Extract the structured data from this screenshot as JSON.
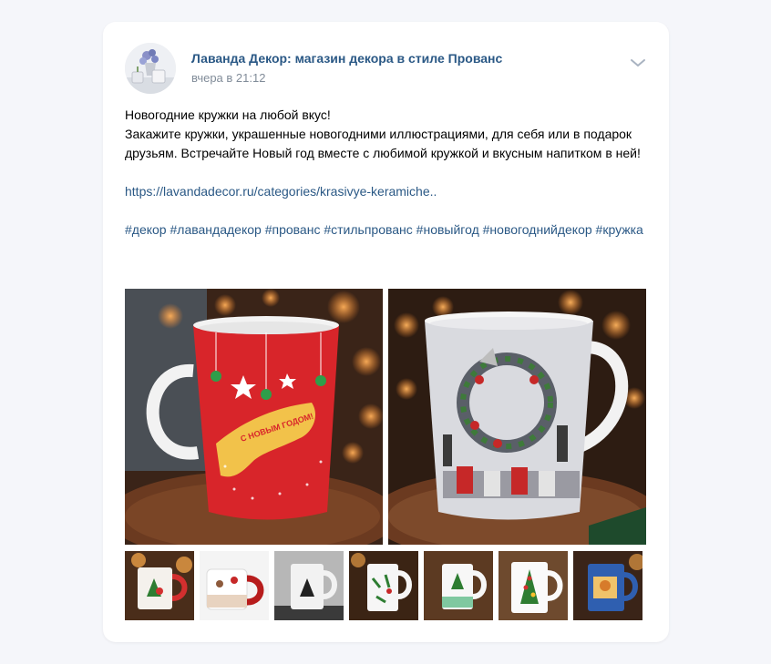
{
  "post": {
    "author": "Лаванда Декор: магазин декора в стиле Прованс",
    "time": "вчера в 21:12",
    "text_lines": [
      "Новогодние кружки на любой вкус!",
      "Закажите кружки, украшенные новогодними иллюстрациями, для себя или в подарок друзьям. Встречайте Новый год вместе с любимой кружкой и вкусным напитком в ней!"
    ],
    "link": "https://lavandadecor.ru/categories/krasivye-keramiche..",
    "hashtags": [
      "#декор",
      "#лавандадекор",
      "#прованс",
      "#стильпрованс",
      "#новыйгод",
      "#новогоднийдекор",
      "#кружка"
    ],
    "mug_text": "С НОВЫМ ГОДОМ!"
  },
  "icons": {
    "menu": "chevron-down-icon"
  },
  "colors": {
    "link": "#2a5885",
    "meta": "#818c99",
    "card": "#ffffff",
    "background": "#f5f6fa"
  }
}
